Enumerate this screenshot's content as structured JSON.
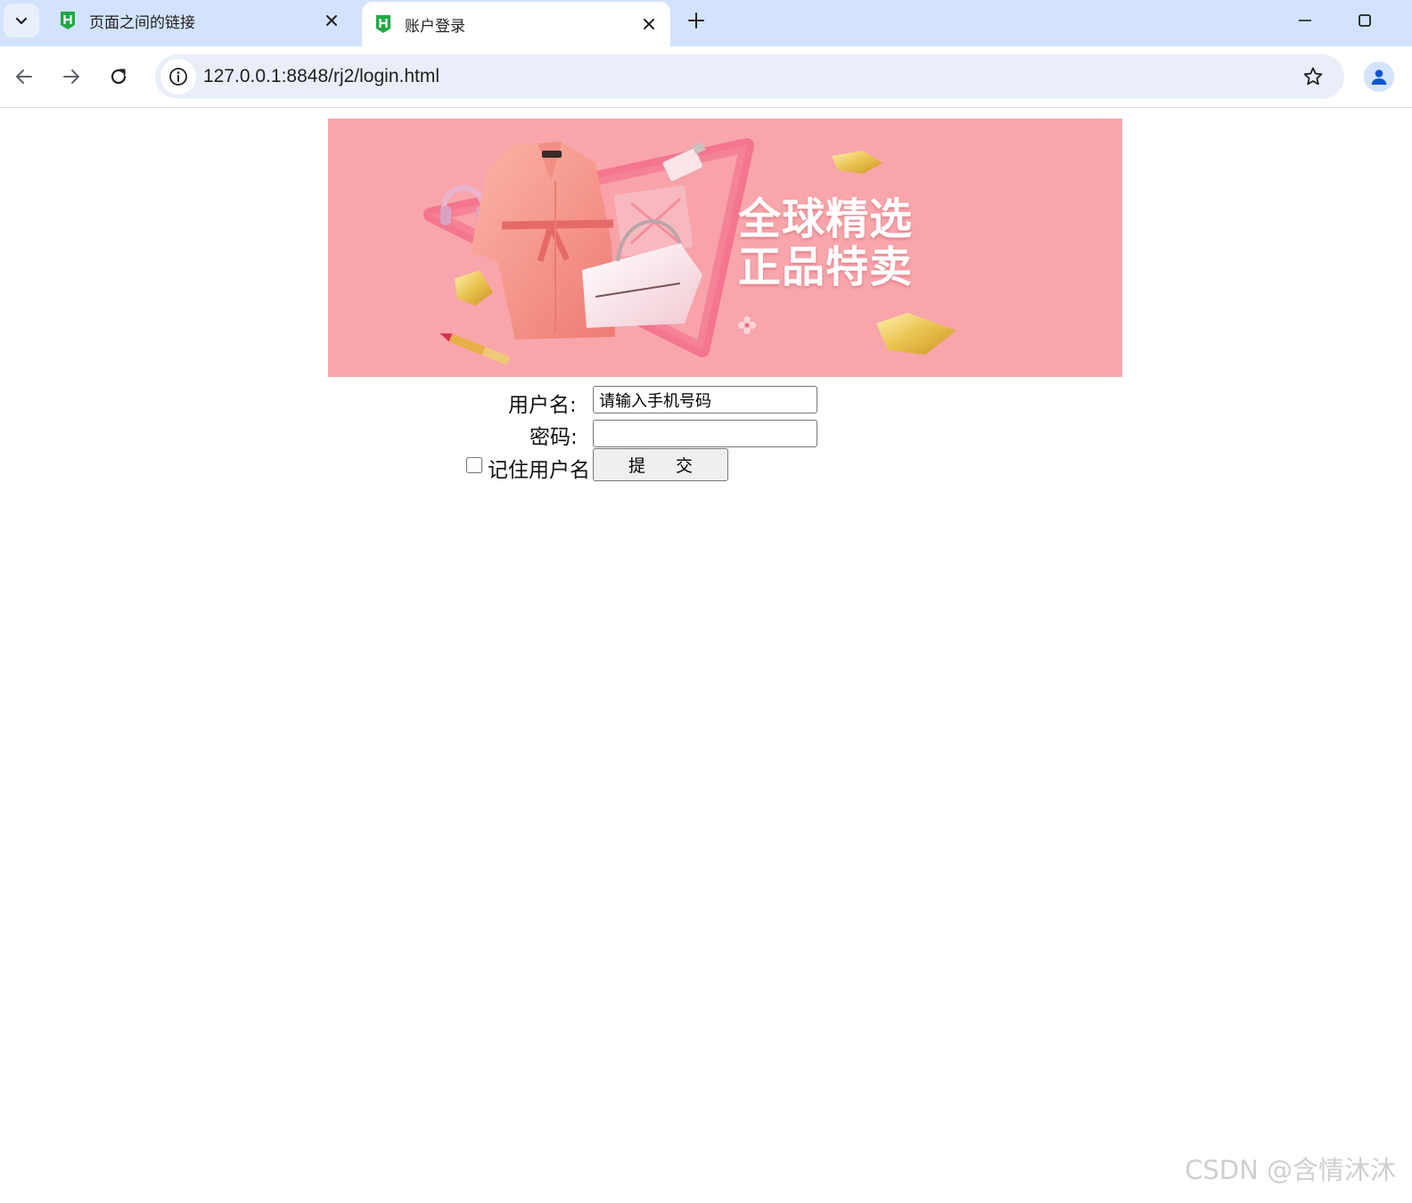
{
  "browser": {
    "tabs": [
      {
        "title": "页面之间的链接",
        "active": false
      },
      {
        "title": "账户登录",
        "active": true
      }
    ],
    "url": "127.0.0.1:8848/rj2/login.html"
  },
  "banner": {
    "slogan_line1": "全球精选",
    "slogan_line2": "正品特卖",
    "background_color": "#f8a6ac"
  },
  "form": {
    "username_label": "用户名:",
    "username_value": "请输入手机号码",
    "password_label": "密码:",
    "password_value": "",
    "remember_label": "记住用户名",
    "remember_checked": false,
    "submit_label": "提 交"
  },
  "watermark": "CSDN @含情沐沐",
  "icons": {
    "tab_search": "chevron-down-icon",
    "favicon": "hbuilder-h-icon",
    "close": "close-icon",
    "new_tab": "plus-icon",
    "minimize": "minimize-icon",
    "maximize": "maximize-icon",
    "back": "back-arrow-icon",
    "forward": "forward-arrow-icon",
    "reload": "reload-icon",
    "site_info": "info-icon",
    "bookmark": "star-icon",
    "profile": "person-icon"
  },
  "colors": {
    "tabstrip": "#d3e3fd",
    "favicon_green": "#22a845",
    "omnibox": "#e9eef8"
  }
}
